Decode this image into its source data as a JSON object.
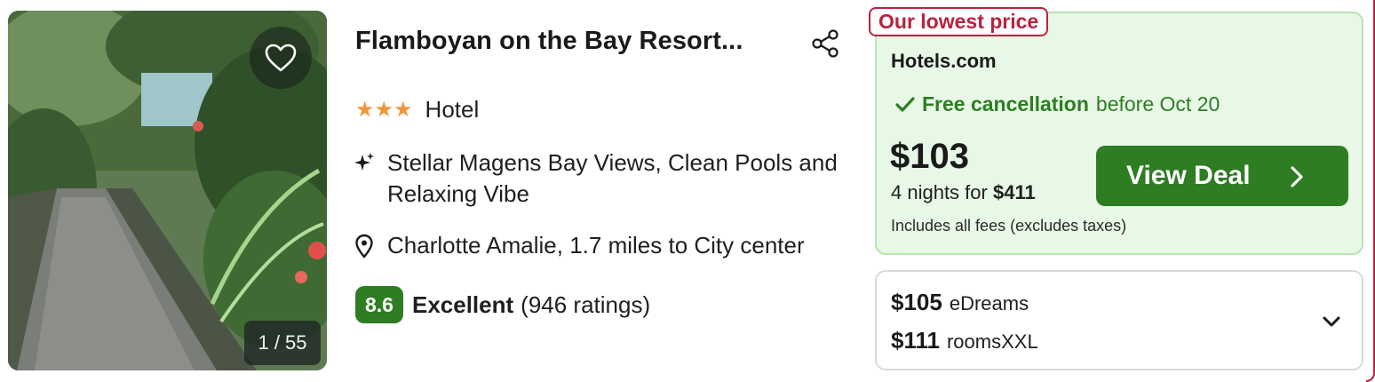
{
  "hotel": {
    "name": "Flamboyan on the Bay Resort...",
    "stars": "★★★",
    "type": "Hotel",
    "highlight": "Stellar Magens Bay Views, Clean Pools and Relaxing Vibe",
    "location": "Charlotte Amalie, 1.7 miles to City center",
    "score": "8.6",
    "score_label": "Excellent",
    "ratings": "(946 ratings)",
    "photo_counter": "1 / 55"
  },
  "deal": {
    "tag": "Our lowest price",
    "provider": "Hotels.com",
    "cancellation_strong": "Free cancellation",
    "cancellation_rest": "before Oct 20",
    "price": "$103",
    "nights_text": "4 nights for",
    "total": "$411",
    "fees_note": "Includes all fees (excludes taxes)",
    "cta_label": "View Deal"
  },
  "other_offers": [
    {
      "price": "$105",
      "provider": "eDreams"
    },
    {
      "price": "$111",
      "provider": "roomsXXL"
    }
  ],
  "icons": {
    "favorite": "heart-icon",
    "share": "share-icon",
    "highlight": "sparkle-icon",
    "location": "map-pin-icon",
    "cancellation": "check-icon",
    "cta": "chevron-right-icon",
    "expand": "chevron-down-icon"
  },
  "colors": {
    "accent_green": "#2e7d23",
    "deal_bg": "#e8f8e6",
    "tag_red": "#b8233e",
    "star_orange": "#f0963a"
  }
}
